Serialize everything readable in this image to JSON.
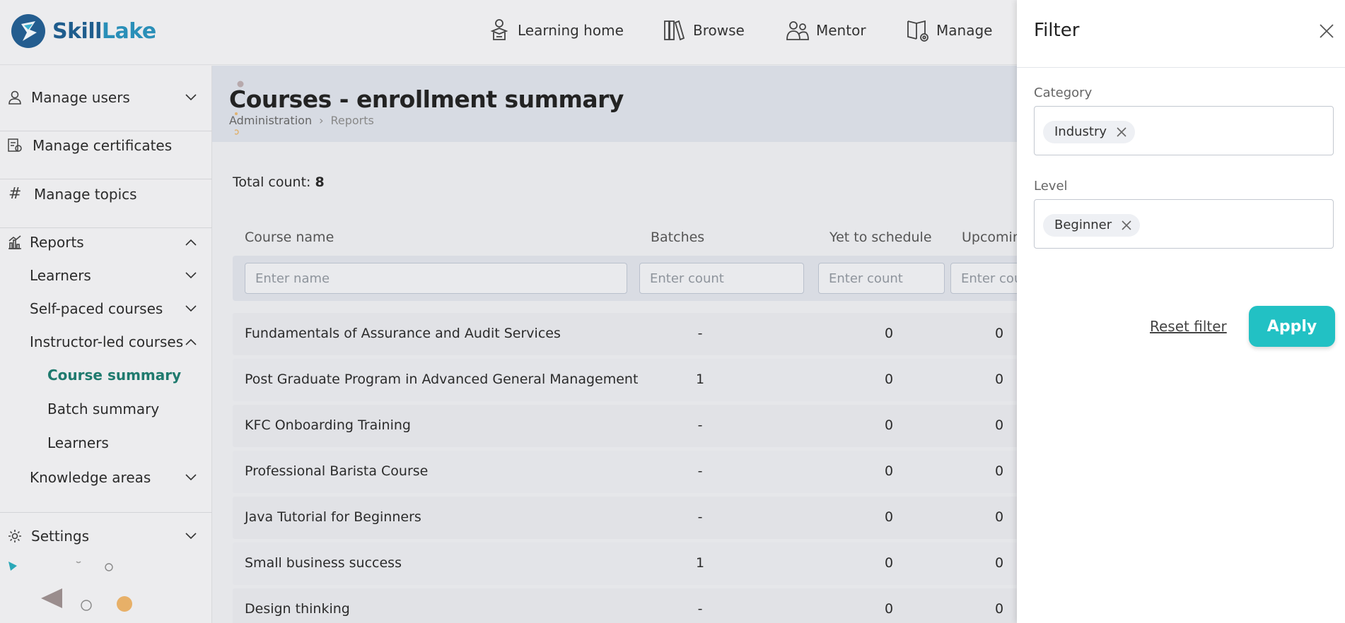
{
  "brand": {
    "name_part1": "Skill",
    "name_part2": "Lake",
    "colors": {
      "primary": "#1f5d8d",
      "accent": "#22c1c4",
      "active_link": "#1f7a6e"
    }
  },
  "nav": [
    {
      "label": "Learning home",
      "icon": "learner-icon"
    },
    {
      "label": "Browse",
      "icon": "books-icon"
    },
    {
      "label": "Mentor",
      "icon": "mentor-icon"
    },
    {
      "label": "Manage",
      "icon": "manage-book-icon"
    }
  ],
  "sidebar": {
    "manage_users": "Manage users",
    "manage_certificates": "Manage certificates",
    "manage_topics": "Manage topics",
    "reports": "Reports",
    "learners": "Learners",
    "self_paced": "Self-paced courses",
    "instructor_led": "Instructor-led courses",
    "course_summary": "Course summary",
    "batch_summary": "Batch summary",
    "learners_sub": "Learners",
    "knowledge_areas": "Knowledge areas",
    "settings": "Settings"
  },
  "page": {
    "title": "Courses - enrollment summary",
    "breadcrumb": [
      "Administration",
      "Reports"
    ],
    "total_label": "Total count:",
    "total_value": "8"
  },
  "table": {
    "headers": [
      "Course name",
      "Batches",
      "Yet to schedule",
      "Upcomin"
    ],
    "filters": {
      "name_placeholder": "Enter name",
      "count_placeholder": "Enter count",
      "count_placeholder_partial": "Enter cou"
    },
    "rows": [
      {
        "name": "Fundamentals of Assurance and Audit Services",
        "batches": "-",
        "yet": "0",
        "upcoming": "0"
      },
      {
        "name": "Post Graduate Program in Advanced General Management",
        "batches": "1",
        "yet": "0",
        "upcoming": "0"
      },
      {
        "name": "KFC Onboarding Training",
        "batches": "-",
        "yet": "0",
        "upcoming": "0"
      },
      {
        "name": "Professional Barista Course",
        "batches": "-",
        "yet": "0",
        "upcoming": "0"
      },
      {
        "name": "Java Tutorial for Beginners",
        "batches": "-",
        "yet": "0",
        "upcoming": "0"
      },
      {
        "name": "Small business success",
        "batches": "1",
        "yet": "0",
        "upcoming": "0"
      },
      {
        "name": "Design thinking",
        "batches": "-",
        "yet": "0",
        "upcoming": "0"
      }
    ]
  },
  "filter_panel": {
    "title": "Filter",
    "category_label": "Category",
    "category_chip": "Industry",
    "level_label": "Level",
    "level_chip": "Beginner",
    "reset_label": "Reset filter",
    "apply_label": "Apply"
  }
}
